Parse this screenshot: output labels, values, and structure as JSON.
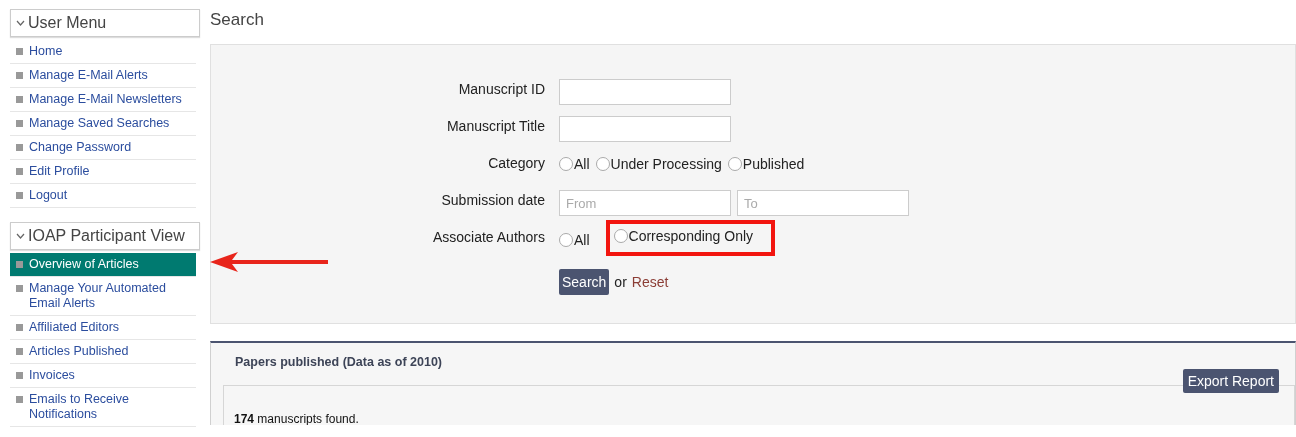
{
  "sidebar": {
    "sections": [
      {
        "title": "User Menu",
        "expanded": true,
        "items": [
          {
            "label": "Home",
            "selected": false
          },
          {
            "label": "Manage E-Mail Alerts",
            "selected": false
          },
          {
            "label": "Manage E-Mail Newsletters",
            "selected": false
          },
          {
            "label": "Manage Saved Searches",
            "selected": false
          },
          {
            "label": "Change Password",
            "selected": false
          },
          {
            "label": "Edit Profile",
            "selected": false
          },
          {
            "label": "Logout",
            "selected": false
          }
        ]
      },
      {
        "title": "IOAP Participant View",
        "expanded": true,
        "items": [
          {
            "label": "Overview of Articles",
            "selected": true
          },
          {
            "label": "Manage Your Automated Email Alerts",
            "selected": false
          },
          {
            "label": "Affiliated Editors",
            "selected": false
          },
          {
            "label": "Articles Published",
            "selected": false
          },
          {
            "label": "Invoices",
            "selected": false
          },
          {
            "label": "Emails to Receive Notifications",
            "selected": false
          }
        ]
      }
    ]
  },
  "page_title": "Search",
  "search_form": {
    "fields": [
      {
        "kind": "text",
        "label": "Manuscript ID"
      },
      {
        "kind": "text",
        "label": "Manuscript Title"
      },
      {
        "kind": "radio",
        "label": "Category",
        "options": [
          {
            "label": "All",
            "checked": false,
            "highlighted": false
          },
          {
            "label": "Under Processing",
            "checked": false,
            "highlighted": false
          },
          {
            "label": "Published",
            "checked": false,
            "highlighted": false
          }
        ]
      },
      {
        "kind": "range",
        "label": "Submission date",
        "placeholders": [
          "From",
          "To"
        ]
      },
      {
        "kind": "radio",
        "label": "Associate Authors",
        "options": [
          {
            "label": "All",
            "checked": false,
            "highlighted": false
          },
          {
            "label": "Corresponding Only",
            "checked": false,
            "highlighted": true
          }
        ]
      }
    ],
    "search_button": "Search",
    "or_text": "or",
    "reset_link": "Reset"
  },
  "results": {
    "title": "Papers published (Data as of 2010)",
    "export_button": "Export Report",
    "count": "174",
    "count_text": " manuscripts found."
  }
}
